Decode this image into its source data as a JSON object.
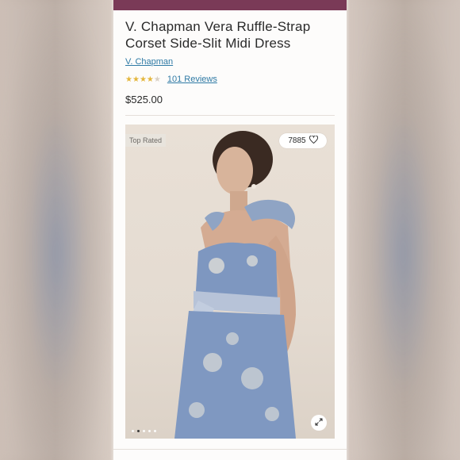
{
  "product": {
    "title": "V. Chapman Vera Ruffle-Strap Corset Side-Slit Midi Dress",
    "brand": "V. Chapman",
    "rating_stars": 4.5,
    "reviews_label": "101 Reviews",
    "price": "$525.00"
  },
  "gallery": {
    "badge": "Top Rated",
    "likes_count": "7885",
    "dots_total": 5,
    "dots_active_index": 1
  },
  "colors": {
    "topbar": "#7a3a57",
    "link": "#2f7aa5",
    "stars": "#e4b63c"
  },
  "icons": [
    "heart-icon",
    "expand-icon",
    "star-icon"
  ]
}
